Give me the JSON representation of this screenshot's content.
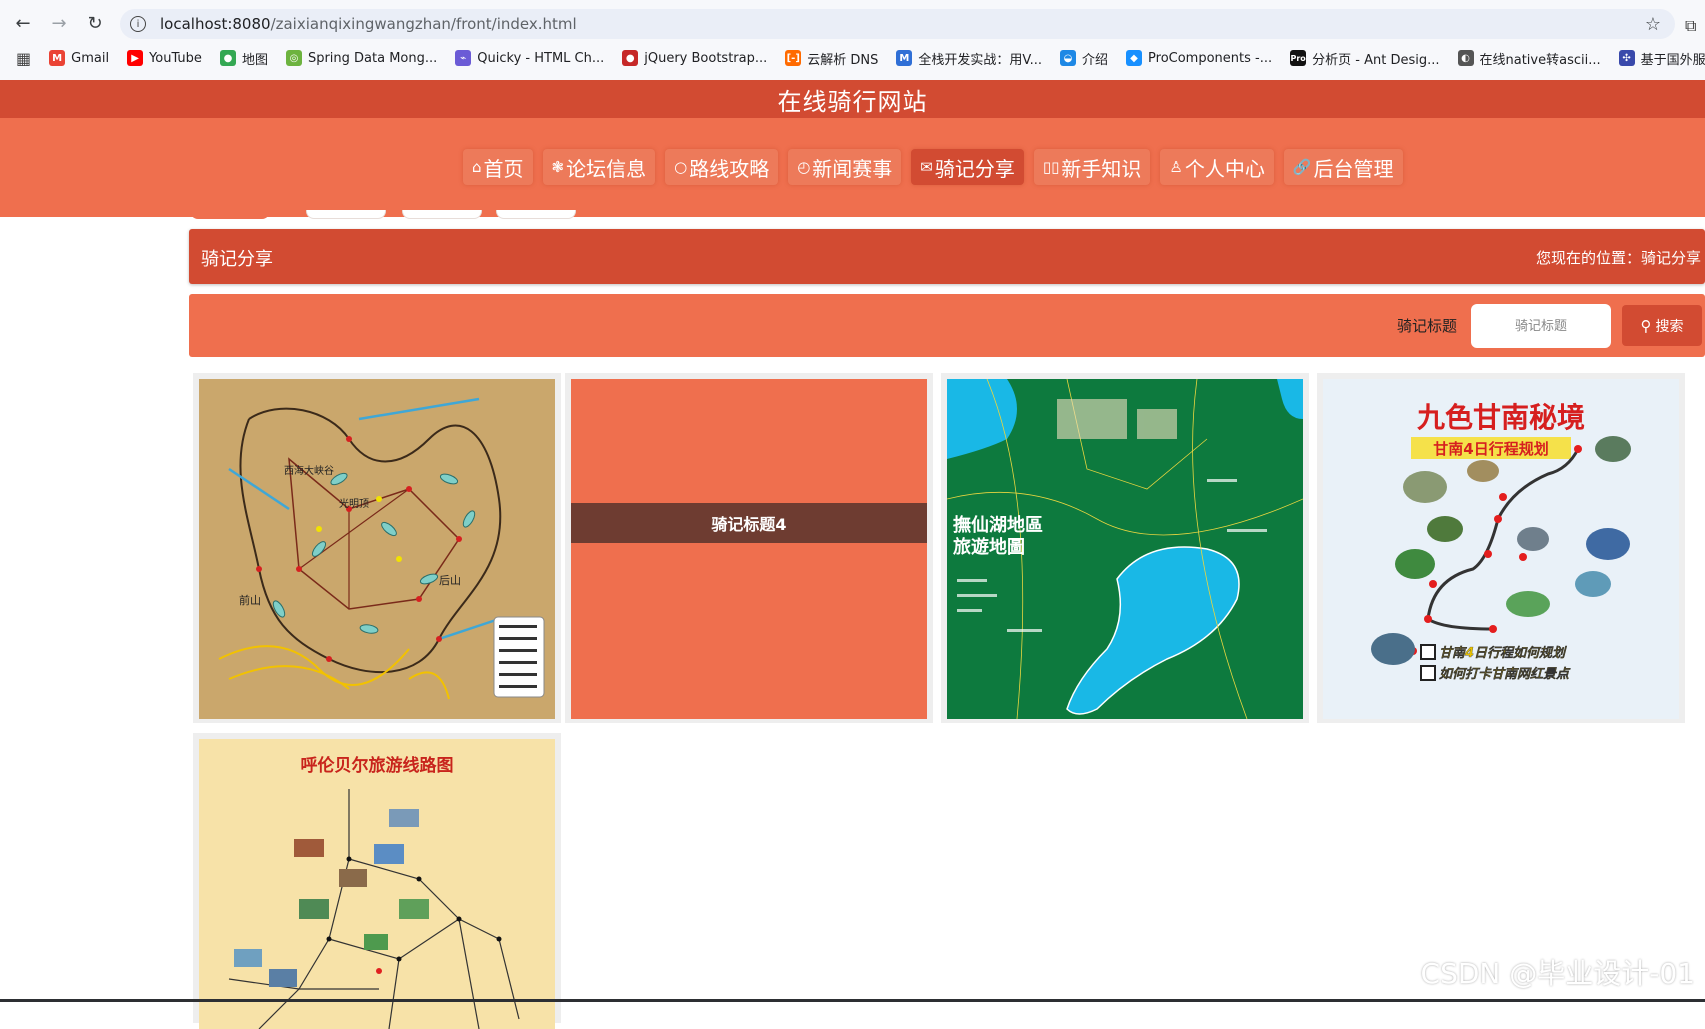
{
  "browser": {
    "url_host": "localhost:8080",
    "url_path": "/zaixianqixingwangzhan/front/index.html",
    "bookmarks": [
      {
        "label": "Gmail",
        "icon": "gmail-icon",
        "color": "#ea4335",
        "glyph": "M"
      },
      {
        "label": "YouTube",
        "icon": "youtube-icon",
        "color": "#ff0000",
        "glyph": "▶"
      },
      {
        "label": "地图",
        "icon": "maps-icon",
        "color": "#34a853",
        "glyph": "●"
      },
      {
        "label": "Spring Data Mong...",
        "icon": "spring-icon",
        "color": "#6db33f",
        "glyph": "◎"
      },
      {
        "label": "Quicky - HTML Ch...",
        "icon": "quicky-icon",
        "color": "#6b5bd6",
        "glyph": "⌁"
      },
      {
        "label": "jQuery Bootstrap...",
        "icon": "jquery-icon",
        "color": "#c62828",
        "glyph": "●"
      },
      {
        "label": "云解析 DNS",
        "icon": "aliyun-icon",
        "color": "#ff6a00",
        "glyph": "[-]"
      },
      {
        "label": "全栈开发实战：用V...",
        "icon": "m-icon",
        "color": "#2f6fd6",
        "glyph": "M"
      },
      {
        "label": "介绍",
        "icon": "globe-icon",
        "color": "#1e88e5",
        "glyph": "◒"
      },
      {
        "label": "ProComponents -...",
        "icon": "procomponents-icon",
        "color": "#1890ff",
        "glyph": "◆"
      },
      {
        "label": "分析页 - Ant Desig...",
        "icon": "pro-icon",
        "color": "#111111",
        "glyph": "Pro"
      },
      {
        "label": "在线native转ascii...",
        "icon": "ascii-icon",
        "color": "#555555",
        "glyph": "◐"
      },
      {
        "label": "基于国外服务器搭...",
        "icon": "server-icon",
        "color": "#3949ab",
        "glyph": "✣"
      }
    ]
  },
  "site": {
    "title": "在线骑行网站",
    "nav": [
      {
        "label": "首页",
        "icon": "home-icon",
        "glyph": "⌂",
        "active": false
      },
      {
        "label": "论坛信息",
        "icon": "forum-icon",
        "glyph": "❃",
        "active": false
      },
      {
        "label": "路线攻略",
        "icon": "route-icon",
        "glyph": "○",
        "active": false
      },
      {
        "label": "新闻赛事",
        "icon": "news-icon",
        "glyph": "◴",
        "active": false
      },
      {
        "label": "骑记分享",
        "icon": "mail-icon",
        "glyph": "✉",
        "active": true
      },
      {
        "label": "新手知识",
        "icon": "book-icon",
        "glyph": "▯▯",
        "active": false
      },
      {
        "label": "个人中心",
        "icon": "user-icon",
        "glyph": "♙",
        "active": false
      },
      {
        "label": "后台管理",
        "icon": "link-icon",
        "glyph": "🔗",
        "active": false
      }
    ]
  },
  "breadcrumb": {
    "title": "骑记分享",
    "location_prefix": "您现在的位置：",
    "location": "骑记分享"
  },
  "search": {
    "label": "骑记标题",
    "placeholder": "骑记标题",
    "button_label": "搜索"
  },
  "cards": [
    {
      "kind": "map-tan",
      "title": ""
    },
    {
      "kind": "fallback",
      "title": "骑记标题4"
    },
    {
      "kind": "map-green",
      "title": ""
    },
    {
      "kind": "map-gannan",
      "title": ""
    },
    {
      "kind": "map-hulunbuir",
      "title": ""
    }
  ],
  "map_texts": {
    "gannan_title": "九色甘南秘境",
    "gannan_sub": "甘南4日行程规划",
    "gannan_check1": "甘南4日行程如何规划",
    "gannan_check2": "如何打卡甘南网红景点",
    "fuxian_title_1": "撫仙湖地區",
    "fuxian_title_2": "旅遊地圖",
    "hulun_title": "呼伦贝尔旅游线路图",
    "tan_label_1": "西海大峡谷",
    "tan_label_2": "光明顶",
    "tan_label_3": "前山",
    "tan_label_4": "后山"
  },
  "watermark": "CSDN @毕业设计-01",
  "colors": {
    "primary": "#d24b32",
    "secondary": "#ef6f4e",
    "card_title_strip": "#6e3c31"
  }
}
